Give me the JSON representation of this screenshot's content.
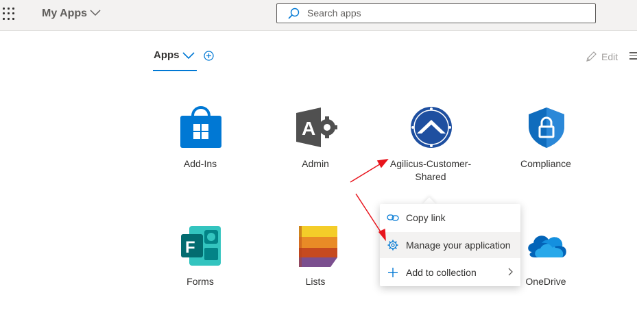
{
  "header": {
    "app_title": "My Apps",
    "search_placeholder": "Search apps"
  },
  "toolbar": {
    "tab_label": "Apps",
    "edit_label": "Edit"
  },
  "apps": [
    {
      "name": "Add-Ins",
      "icon": "store-bag-icon"
    },
    {
      "name": "Admin",
      "icon": "admin-gear-icon"
    },
    {
      "name": "Agilicus-Customer-Shared",
      "icon": "agilicus-logo-icon"
    },
    {
      "name": "Compliance",
      "icon": "shield-lock-icon"
    },
    {
      "name": "Forms",
      "icon": "forms-icon"
    },
    {
      "name": "Lists",
      "icon": "lists-icon"
    },
    {
      "name": "OneDrive",
      "icon": "cloud-icon"
    }
  ],
  "context_menu": {
    "items": [
      {
        "label": "Copy link",
        "icon": "link-icon"
      },
      {
        "label": "Manage your application",
        "icon": "settings-gear-icon"
      },
      {
        "label": "Add to collection",
        "icon": "plus-icon"
      }
    ]
  },
  "colors": {
    "accent": "#0078d4",
    "annotation_arrow": "#e8141c"
  }
}
